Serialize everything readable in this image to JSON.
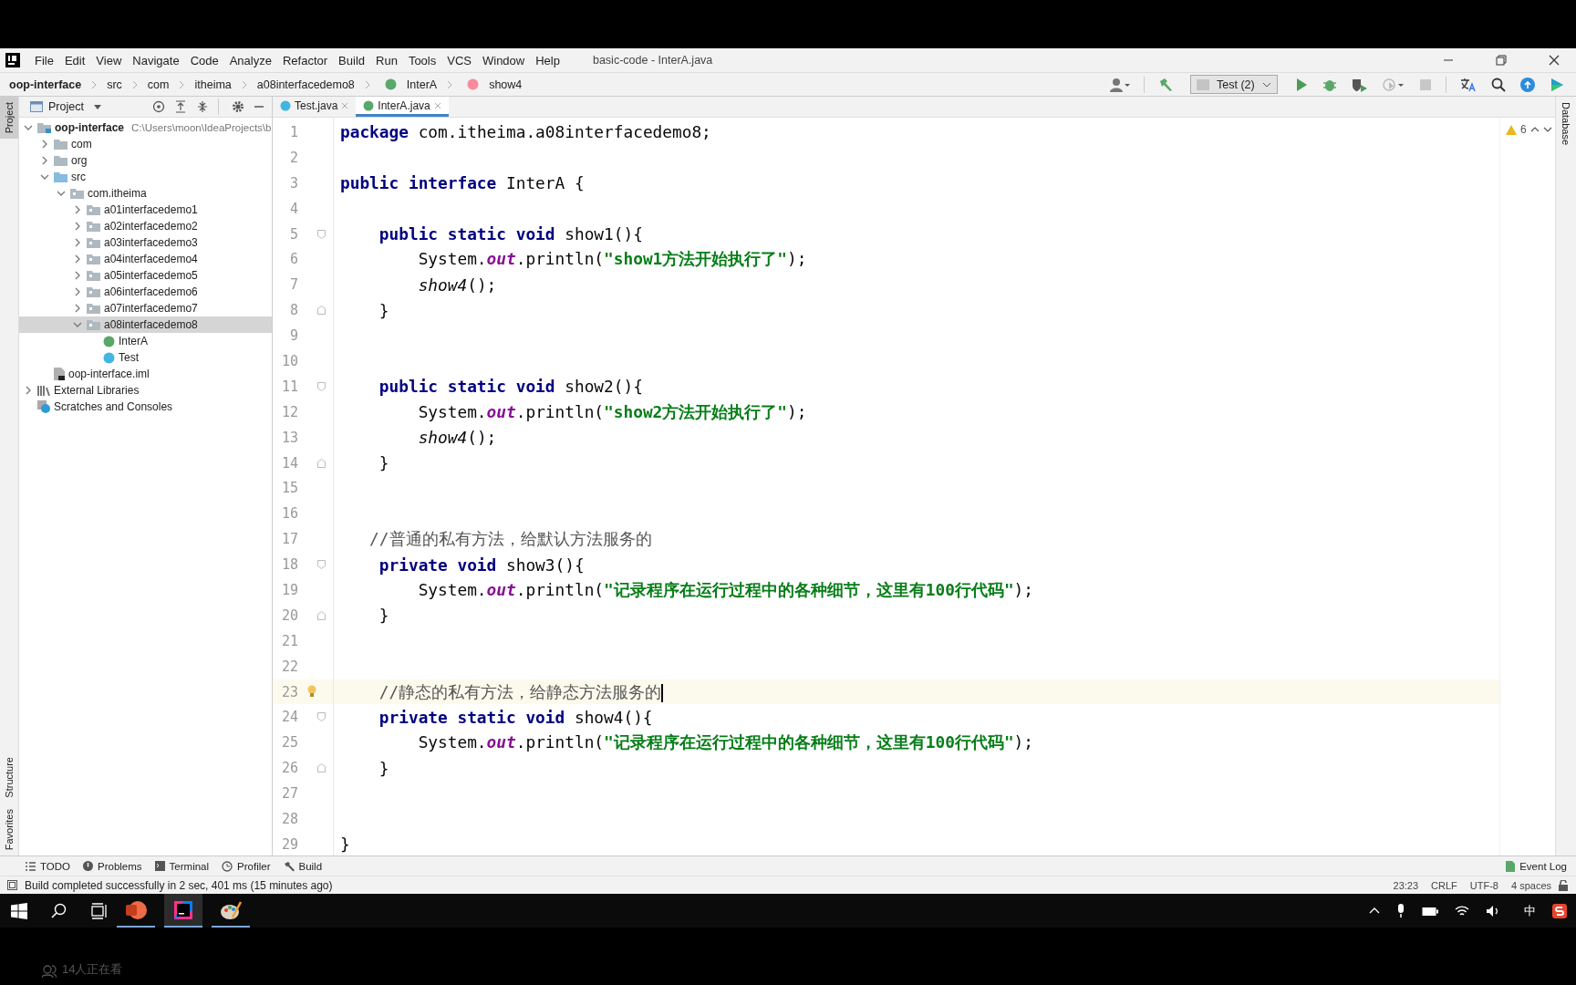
{
  "window": {
    "title": "basic-code - InterA.java",
    "menus": [
      "File",
      "Edit",
      "View",
      "Navigate",
      "Code",
      "Analyze",
      "Refactor",
      "Build",
      "Run",
      "Tools",
      "VCS",
      "Window",
      "Help"
    ]
  },
  "breadcrumbs": [
    {
      "label": "oop-interface",
      "kind": "project"
    },
    {
      "label": "src",
      "kind": "folder"
    },
    {
      "label": "com",
      "kind": "folder"
    },
    {
      "label": "itheima",
      "kind": "folder"
    },
    {
      "label": "a08interfacedemo8",
      "kind": "folder"
    },
    {
      "label": "InterA",
      "kind": "interface"
    },
    {
      "label": "show4",
      "kind": "method"
    }
  ],
  "toolbar": {
    "run_config": "Test (2)"
  },
  "left_stripe": {
    "top": [
      {
        "label": "Project",
        "selected": true
      }
    ],
    "bottom": [
      {
        "label": "Structure",
        "selected": false
      },
      {
        "label": "Favorites",
        "selected": false
      }
    ]
  },
  "right_stripe": [
    {
      "label": "Database",
      "selected": false
    }
  ],
  "project_panel": {
    "title": "Project",
    "tree": [
      {
        "label": "oop-interface",
        "path": "C:\\Users\\moon\\IdeaProjects\\b",
        "kind": "module",
        "expanded": true,
        "selected": false,
        "children": [
          {
            "label": "com",
            "kind": "folder",
            "expanded": false,
            "selected": false
          },
          {
            "label": "org",
            "kind": "folder",
            "expanded": false,
            "selected": false
          },
          {
            "label": "src",
            "kind": "source",
            "expanded": true,
            "selected": false,
            "children": [
              {
                "label": "com.itheima",
                "kind": "package",
                "expanded": true,
                "selected": false,
                "children": [
                  {
                    "label": "a01interfacedemo1",
                    "kind": "package",
                    "expanded": false,
                    "selected": false
                  },
                  {
                    "label": "a02interfacedemo2",
                    "kind": "package",
                    "expanded": false,
                    "selected": false
                  },
                  {
                    "label": "a03interfacedemo3",
                    "kind": "package",
                    "expanded": false,
                    "selected": false
                  },
                  {
                    "label": "a04interfacedemo4",
                    "kind": "package",
                    "expanded": false,
                    "selected": false
                  },
                  {
                    "label": "a05interfacedemo5",
                    "kind": "package",
                    "expanded": false,
                    "selected": false
                  },
                  {
                    "label": "a06interfacedemo6",
                    "kind": "package",
                    "expanded": false,
                    "selected": false
                  },
                  {
                    "label": "a07interfacedemo7",
                    "kind": "package",
                    "expanded": false,
                    "selected": false
                  },
                  {
                    "label": "a08interfacedemo8",
                    "kind": "package",
                    "expanded": true,
                    "selected": true,
                    "children": [
                      {
                        "label": "InterA",
                        "kind": "interface",
                        "selected": false
                      },
                      {
                        "label": "Test",
                        "kind": "class",
                        "selected": false
                      }
                    ]
                  }
                ]
              }
            ]
          },
          {
            "label": "oop-interface.iml",
            "kind": "iml",
            "selected": false
          }
        ]
      },
      {
        "label": "External Libraries",
        "kind": "libraries",
        "expanded": false,
        "selected": false
      },
      {
        "label": "Scratches and Consoles",
        "kind": "scratches",
        "selected": false
      }
    ]
  },
  "editor_tabs": [
    {
      "label": "Test.java",
      "kind": "class",
      "selected": false
    },
    {
      "label": "InterA.java",
      "kind": "interface",
      "selected": true
    }
  ],
  "editor": {
    "warnings": "6",
    "lines": [
      {
        "number": "1",
        "kind": "code",
        "current": false,
        "tokens": [
          {
            "t": "package ",
            "kind": "keyword"
          },
          {
            "t": "com.itheima.a08interfacedemo8;",
            "kind": "plain"
          }
        ]
      },
      {
        "number": "2",
        "kind": "code",
        "current": false
      },
      {
        "number": "3",
        "kind": "code",
        "current": false,
        "tokens": [
          {
            "t": "public interface ",
            "kind": "keyword"
          },
          {
            "t": "InterA {",
            "kind": "plain"
          }
        ]
      },
      {
        "number": "4",
        "kind": "code",
        "current": false
      },
      {
        "number": "5",
        "kind": "block_start",
        "current": false,
        "tokens": [
          {
            "t": "    public static void ",
            "kind": "keyword"
          },
          {
            "t": "show1(){",
            "kind": "plain"
          }
        ]
      },
      {
        "number": "6",
        "kind": "code",
        "current": false,
        "tokens": [
          {
            "t": "        System.",
            "kind": "plain"
          },
          {
            "t": "out",
            "kind": "field"
          },
          {
            "t": ".println(",
            "kind": "plain"
          },
          {
            "t": "\"show1方法开始执行了\"",
            "kind": "string"
          },
          {
            "t": ");",
            "kind": "plain"
          }
        ]
      },
      {
        "number": "7",
        "kind": "code",
        "current": false,
        "tokens": [
          {
            "t": "        show4",
            "kind": "static"
          },
          {
            "t": "();",
            "kind": "plain"
          }
        ]
      },
      {
        "number": "8",
        "kind": "block_end",
        "current": false,
        "tokens": [
          {
            "t": "    }",
            "kind": "plain"
          }
        ]
      },
      {
        "number": "9",
        "kind": "code",
        "current": false
      },
      {
        "number": "10",
        "kind": "code",
        "current": false
      },
      {
        "number": "11",
        "kind": "block_start",
        "current": false,
        "tokens": [
          {
            "t": "    public static void ",
            "kind": "keyword"
          },
          {
            "t": "show2(){",
            "kind": "plain"
          }
        ]
      },
      {
        "number": "12",
        "kind": "code",
        "current": false,
        "tokens": [
          {
            "t": "        System.",
            "kind": "plain"
          },
          {
            "t": "out",
            "kind": "field"
          },
          {
            "t": ".println(",
            "kind": "plain"
          },
          {
            "t": "\"show2方法开始执行了\"",
            "kind": "string"
          },
          {
            "t": ");",
            "kind": "plain"
          }
        ]
      },
      {
        "number": "13",
        "kind": "code",
        "current": false,
        "tokens": [
          {
            "t": "        show4",
            "kind": "static"
          },
          {
            "t": "();",
            "kind": "plain"
          }
        ]
      },
      {
        "number": "14",
        "kind": "block_end",
        "current": false,
        "tokens": [
          {
            "t": "    }",
            "kind": "plain"
          }
        ]
      },
      {
        "number": "15",
        "kind": "code",
        "current": false
      },
      {
        "number": "16",
        "kind": "code",
        "current": false
      },
      {
        "number": "17",
        "kind": "code",
        "current": false,
        "tokens": [
          {
            "t": "   //普通的私有方法，给默认方法服务的",
            "kind": "comment"
          }
        ]
      },
      {
        "number": "18",
        "kind": "block_start",
        "current": false,
        "tokens": [
          {
            "t": "    private void ",
            "kind": "keyword"
          },
          {
            "t": "show3(){",
            "kind": "plain"
          }
        ]
      },
      {
        "number": "19",
        "kind": "code",
        "current": false,
        "tokens": [
          {
            "t": "        System.",
            "kind": "plain"
          },
          {
            "t": "out",
            "kind": "field"
          },
          {
            "t": ".println(",
            "kind": "plain"
          },
          {
            "t": "\"记录程序在运行过程中的各种细节，这里有100行代码\"",
            "kind": "string"
          },
          {
            "t": ");",
            "kind": "plain"
          }
        ]
      },
      {
        "number": "20",
        "kind": "block_end",
        "current": false,
        "tokens": [
          {
            "t": "    }",
            "kind": "plain"
          }
        ]
      },
      {
        "number": "21",
        "kind": "code",
        "current": false
      },
      {
        "number": "22",
        "kind": "code",
        "current": false
      },
      {
        "number": "23",
        "kind": "code",
        "current": true,
        "tokens": [
          {
            "t": "    //静态的私有方法，给静态方法服务的",
            "kind": "comment"
          }
        ]
      },
      {
        "number": "24",
        "kind": "block_start",
        "current": false,
        "tokens": [
          {
            "t": "    private static void ",
            "kind": "keyword"
          },
          {
            "t": "show4(){",
            "kind": "plain"
          }
        ]
      },
      {
        "number": "25",
        "kind": "code",
        "current": false,
        "tokens": [
          {
            "t": "        System.",
            "kind": "plain"
          },
          {
            "t": "out",
            "kind": "field"
          },
          {
            "t": ".println(",
            "kind": "plain"
          },
          {
            "t": "\"记录程序在运行过程中的各种细节，这里有100行代码\"",
            "kind": "string"
          },
          {
            "t": ");",
            "kind": "plain"
          }
        ]
      },
      {
        "number": "26",
        "kind": "block_end",
        "current": false,
        "tokens": [
          {
            "t": "    }",
            "kind": "plain"
          }
        ]
      },
      {
        "number": "27",
        "kind": "code",
        "current": false
      },
      {
        "number": "28",
        "kind": "code",
        "current": false
      },
      {
        "number": "29",
        "kind": "code",
        "current": false,
        "tokens": [
          {
            "t": "}",
            "kind": "plain"
          }
        ]
      }
    ]
  },
  "tool_windows": [
    {
      "label": "TODO",
      "kind": "todo"
    },
    {
      "label": "Problems",
      "kind": "problems"
    },
    {
      "label": "Terminal",
      "kind": "terminal"
    },
    {
      "label": "Profiler",
      "kind": "profiler"
    },
    {
      "label": "Build",
      "kind": "build"
    }
  ],
  "event_log": "Event Log",
  "status_bar": {
    "message": "Build completed successfully in 2 sec, 401 ms (15 minutes ago)",
    "position": "23:23",
    "line_separator": "CRLF",
    "encoding": "UTF-8",
    "indent": "4 spaces"
  },
  "taskbar": {
    "apps": [
      {
        "kind": "powerpoint",
        "selected": false
      },
      {
        "kind": "intellij",
        "selected": true
      },
      {
        "kind": "paint",
        "selected": false
      }
    ],
    "ime": "中"
  },
  "viewers": "14人正在看"
}
